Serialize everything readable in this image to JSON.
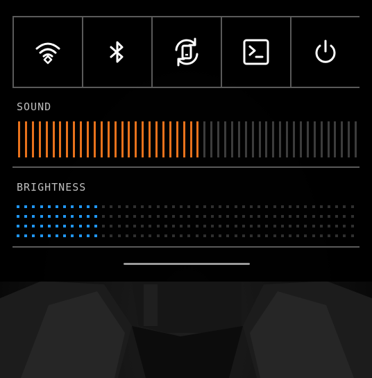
{
  "quick_settings": {
    "toggles": [
      {
        "name": "wifi",
        "icon": "wifi-icon"
      },
      {
        "name": "bluetooth",
        "icon": "bluetooth-icon"
      },
      {
        "name": "auto-rotate",
        "icon": "rotate-icon"
      },
      {
        "name": "terminal",
        "icon": "terminal-icon"
      },
      {
        "name": "power",
        "icon": "power-icon"
      }
    ],
    "sound": {
      "label": "SOUND",
      "level": 0.53,
      "active_color": "#e8721c",
      "inactive_color": "#3c3c3c"
    },
    "brightness": {
      "label": "BRIGHTNESS",
      "level": 0.25,
      "active_color": "#2196f3",
      "inactive_color": "#2f2f2f"
    }
  }
}
